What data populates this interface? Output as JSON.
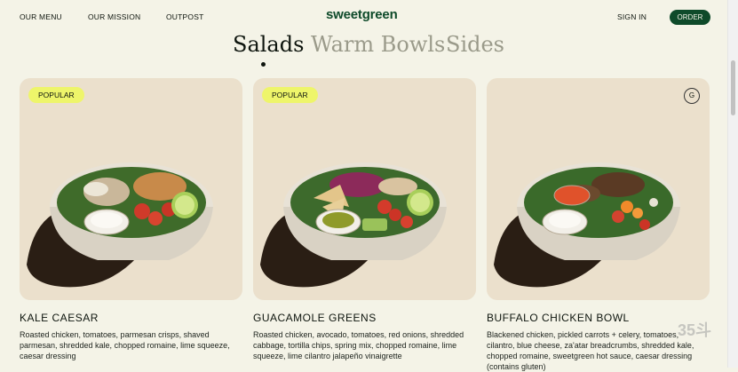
{
  "nav": {
    "links": [
      "OUR MENU",
      "OUR MISSION",
      "OUTPOST"
    ],
    "logo": "sweetgreen",
    "sign_in": "SIGN IN",
    "order": "ORDER"
  },
  "tabs": [
    {
      "label": "Salads",
      "active": true
    },
    {
      "label": "Warm Bowls",
      "active": false
    },
    {
      "label": "Sides",
      "active": false
    }
  ],
  "items": [
    {
      "badge": "POPULAR",
      "name": "KALE CAESAR",
      "description": "Roasted chicken, tomatoes, parmesan crisps, shaved parmesan, shredded kale, chopped romaine, lime squeeze, caesar dressing"
    },
    {
      "badge": "POPULAR",
      "name": "GUACAMOLE GREENS",
      "description": "Roasted chicken, avocado, tomatoes, red onions, shredded cabbage, tortilla chips, spring mix, chopped romaine, lime squeeze, lime cilantro jalapeño vinaigrette"
    },
    {
      "diet_badge": "G",
      "name": "BUFFALO CHICKEN BOWL",
      "description": "Blackened chicken, pickled carrots + celery, tomatoes, cilantro, blue cheese, za'atar breadcrumbs, shredded kale, chopped romaine, sweetgreen hot sauce, caesar dressing (contains gluten)"
    }
  ],
  "watermark": "35斗",
  "colors": {
    "background": "#f4f3e7",
    "brand_green": "#0e4a2a",
    "card": "#ebe0cc",
    "badge": "#eef56a",
    "inactive_tab": "#9a9a8a"
  }
}
